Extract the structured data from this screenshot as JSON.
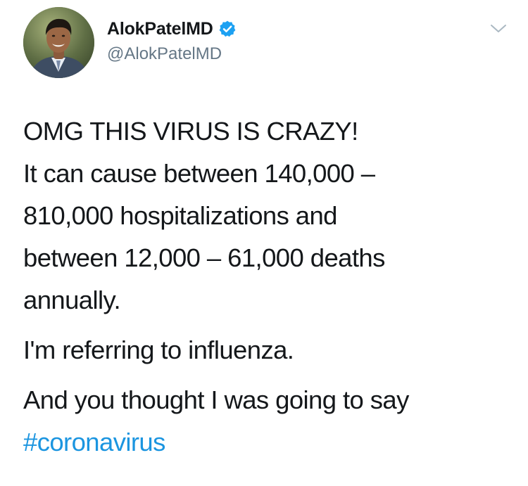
{
  "tweet": {
    "author": {
      "display_name": "AlokPatelMD",
      "handle": "@AlokPatelMD",
      "verified": true,
      "avatar_icon": "avatar-photo"
    },
    "menu_icon": "chevron-down-icon",
    "body": {
      "paragraph_1": [
        "OMG THIS VIRUS IS CRAZY!",
        "It can cause between 140,000 –",
        "810,000 hospitalizations and",
        "between 12,000 – 61,000 deaths",
        "annually."
      ],
      "paragraph_2": "I'm referring to influenza.",
      "paragraph_3": "And you thought I was going to say",
      "hashtag": "#coronavirus"
    },
    "colors": {
      "text": "#14171a",
      "secondary": "#657786",
      "link": "#1b95e0",
      "verified_badge": "#1da1f2"
    }
  }
}
